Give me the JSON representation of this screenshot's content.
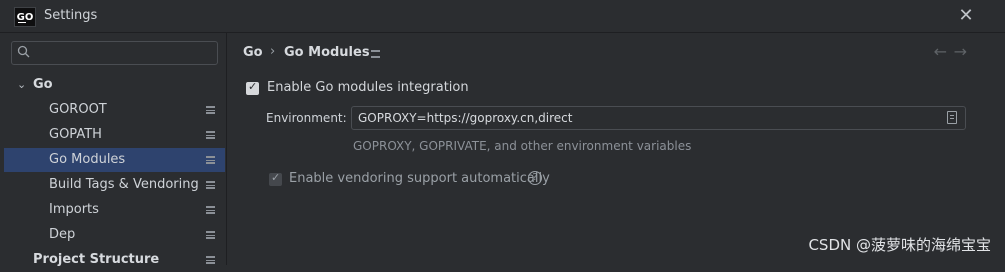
{
  "window": {
    "title": "Settings",
    "logo_text": "GO"
  },
  "sidebar": {
    "search_placeholder": "",
    "items": [
      {
        "label": "Go",
        "chevron": "⌄"
      },
      {
        "label": "GOROOT"
      },
      {
        "label": "GOPATH"
      },
      {
        "label": "Go Modules",
        "selected": true
      },
      {
        "label": "Build Tags & Vendoring"
      },
      {
        "label": "Imports"
      },
      {
        "label": "Dep"
      },
      {
        "label": "Project Structure"
      }
    ]
  },
  "main": {
    "breadcrumb": {
      "parent": "Go",
      "separator": "›",
      "current": "Go Modules"
    },
    "nav": {
      "back": "←",
      "forward": "→"
    },
    "enable_modules": {
      "label": "Enable Go modules integration",
      "checked": true
    },
    "environment": {
      "label": "Environment:",
      "value": "GOPROXY=https://goproxy.cn,direct",
      "hint": "GOPROXY, GOPRIVATE, and other environment variables"
    },
    "vendoring": {
      "label": "Enable vendoring support automatically",
      "checked": true,
      "disabled": true,
      "help": "?"
    }
  },
  "watermark": "CSDN @菠萝味的海绵宝宝",
  "colors": {
    "selection": "#2e436e",
    "background": "#2b2d30"
  }
}
